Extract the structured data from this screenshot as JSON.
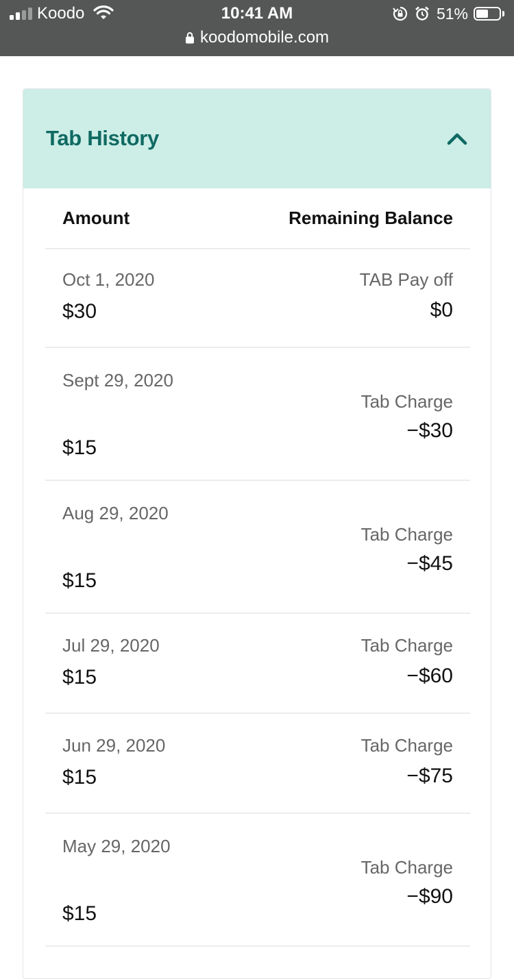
{
  "status_bar": {
    "carrier": "Koodo",
    "time": "10:41 AM",
    "battery_percent": "51%",
    "icons": [
      "signal-icon",
      "wifi-icon",
      "rotation-lock-icon",
      "alarm-icon",
      "battery-icon"
    ]
  },
  "browser": {
    "url": "koodomobile.com",
    "lock_icon": "lock-icon"
  },
  "tab_history": {
    "title": "Tab History",
    "toggle_icon": "chevron-up-icon",
    "columns": {
      "amount": "Amount",
      "balance": "Remaining Balance"
    },
    "rows": [
      {
        "date": "Oct 1, 2020",
        "amount": "$30",
        "type": "TAB Pay off",
        "balance": "$0"
      },
      {
        "date": "Sept 29, 2020",
        "amount": "$15",
        "type": "Tab Charge",
        "balance": "−$30"
      },
      {
        "date": "Aug 29, 2020",
        "amount": "$15",
        "type": "Tab Charge",
        "balance": "−$45"
      },
      {
        "date": "Jul 29, 2020",
        "amount": "$15",
        "type": "Tab Charge",
        "balance": "−$60"
      },
      {
        "date": "Jun 29, 2020",
        "amount": "$15",
        "type": "Tab Charge",
        "balance": "−$75"
      },
      {
        "date": "May 29, 2020",
        "amount": "$15",
        "type": "Tab Charge",
        "balance": "−$90"
      }
    ]
  },
  "colors": {
    "header_bg": "#cdede7",
    "title_text": "#0f6a62",
    "chrome_bg": "#555756"
  }
}
